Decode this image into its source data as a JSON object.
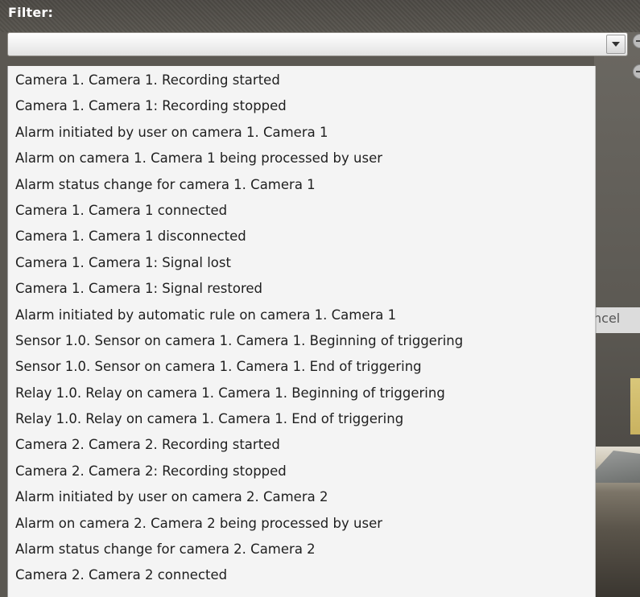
{
  "filter": {
    "label": "Filter:",
    "selected_value": ""
  },
  "background": {
    "cancel_label": "ncel"
  },
  "dropdown": {
    "items": [
      "Camera 1. Camera 1. Recording started",
      "Camera 1. Camera 1: Recording stopped",
      "Alarm initiated by user on camera 1. Camera 1",
      "Alarm on camera 1. Camera 1 being processed by user",
      "Alarm status change for camera 1. Camera 1",
      "Camera 1. Camera 1 connected",
      "Camera 1. Camera 1 disconnected",
      "Camera 1. Camera 1: Signal lost",
      "Camera 1. Camera 1: Signal restored",
      "Alarm initiated by automatic rule on camera 1. Camera 1",
      "Sensor 1.0. Sensor on camera 1. Camera 1. Beginning of triggering",
      "Sensor 1.0. Sensor on camera 1. Camera 1. End of triggering",
      "Relay 1.0. Relay on camera 1. Camera 1. Beginning of triggering",
      "Relay 1.0. Relay on camera 1. Camera 1. End of triggering",
      "Camera 2. Camera 2. Recording started",
      "Camera 2. Camera 2: Recording stopped",
      "Alarm initiated by user on camera 2. Camera 2",
      "Alarm on camera 2. Camera 2 being processed by user",
      "Alarm status change for camera 2. Camera 2",
      "Camera 2. Camera 2 connected"
    ]
  },
  "icons": {
    "dropdown_arrow": "chevron-down-icon",
    "remove_button": "minus-icon"
  },
  "colors": {
    "toolbar_background": "#57544e",
    "list_background": "#f4f4f4",
    "text": "#1e1e1e"
  }
}
